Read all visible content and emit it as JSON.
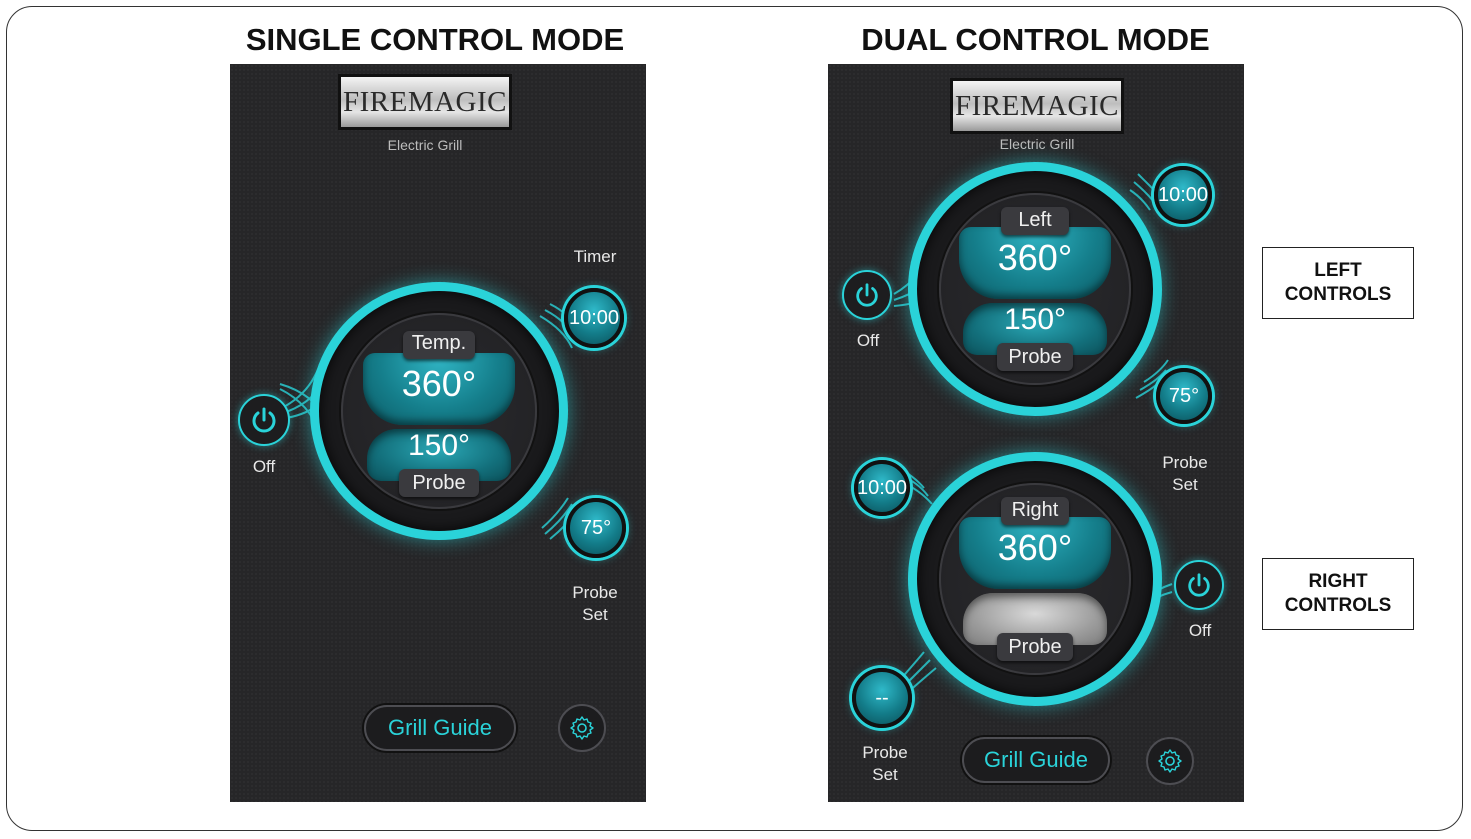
{
  "titles": {
    "single": "SINGLE CONTROL MODE",
    "dual": "DUAL CONTROL MODE"
  },
  "logo": {
    "brand": "FIREMAGIC",
    "subtitle": "Electric Grill"
  },
  "single": {
    "timer_label": "Timer",
    "timer_value": "10:00",
    "dial_label": "Temp.",
    "temp": "360°",
    "probe_temp": "150°",
    "probe_label": "Probe",
    "power_label": "Off",
    "probe_set_value": "75°",
    "probe_set_label_1": "Probe",
    "probe_set_label_2": "Set",
    "grill_guide": "Grill Guide"
  },
  "dual": {
    "left": {
      "timer_value": "10:00",
      "dial_label": "Left",
      "temp": "360°",
      "probe_temp": "150°",
      "probe_label": "Probe",
      "power_label": "Off",
      "probe_set_value": "75°",
      "probe_set_label_1": "Probe",
      "probe_set_label_2": "Set"
    },
    "right": {
      "timer_value": "10:00",
      "dial_label": "Right",
      "temp": "360°",
      "probe_label": "Probe",
      "power_label": "Off",
      "probe_set_value": "--",
      "probe_set_label_1": "Probe",
      "probe_set_label_2": "Set"
    },
    "grill_guide": "Grill Guide"
  },
  "callouts": {
    "left_line1": "LEFT",
    "left_line2": "CONTROLS",
    "right_line1": "RIGHT",
    "right_line2": "CONTROLS"
  },
  "colors": {
    "accent": "#2ad3d9",
    "panel": "#137c89",
    "background": "#262628"
  },
  "icons": [
    "power-icon",
    "gear-icon"
  ]
}
